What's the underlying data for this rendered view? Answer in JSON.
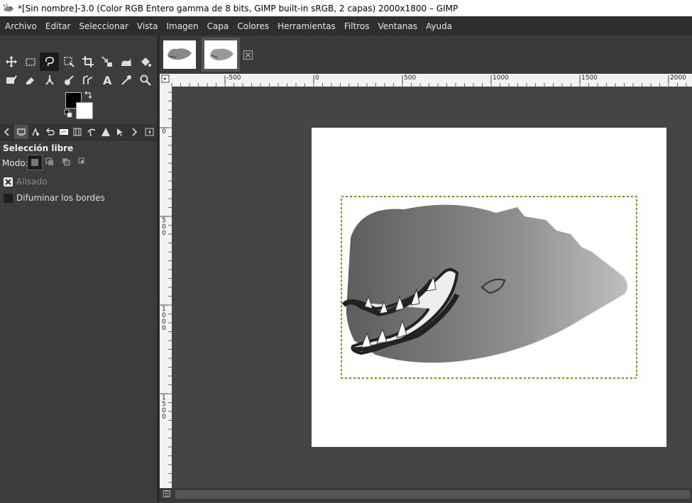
{
  "window": {
    "title": "*[Sin nombre]-3.0 (Color RGB Entero gamma de 8 bits, GIMP built-in sRGB, 2 capas) 2000x1800 – GIMP"
  },
  "menu": [
    "Archivo",
    "Editar",
    "Seleccionar",
    "Vista",
    "Imagen",
    "Capa",
    "Colores",
    "Herramientas",
    "Filtros",
    "Ventanas",
    "Ayuda"
  ],
  "toolbox": {
    "row1": [
      "move-tool-icon",
      "rect-select-tool-icon",
      "free-select-tool-icon",
      "fuzzy-select-tool-icon",
      "crop-tool-icon",
      "unified-transform-tool-icon",
      "warp-transform-tool-icon",
      "bucket-fill-tool-icon"
    ],
    "row2": [
      "paintbrush-tool-icon",
      "eraser-tool-icon",
      "clone-tool-icon",
      "smudge-tool-icon",
      "paths-tool-icon",
      "text-tool-icon",
      "color-picker-tool-icon",
      "zoom-tool-icon"
    ],
    "foreground_color": "#000000",
    "background_color": "#ffffff"
  },
  "tool_options": {
    "title": "Selección libre",
    "mode_label": "Modo:",
    "antialias_label": "Alisado",
    "feather_label": "Difuminar los bordes"
  },
  "rulers": {
    "top_labels": [
      "-500",
      "0",
      "500",
      "1000",
      "1500",
      "2000"
    ],
    "left_labels": [
      "0",
      "500",
      "1000",
      "1500"
    ]
  },
  "colors": {
    "accent": "#ffff00",
    "menubar": "#2e2e2e",
    "panel": "#3c3c3c",
    "canvas": "#454545"
  }
}
